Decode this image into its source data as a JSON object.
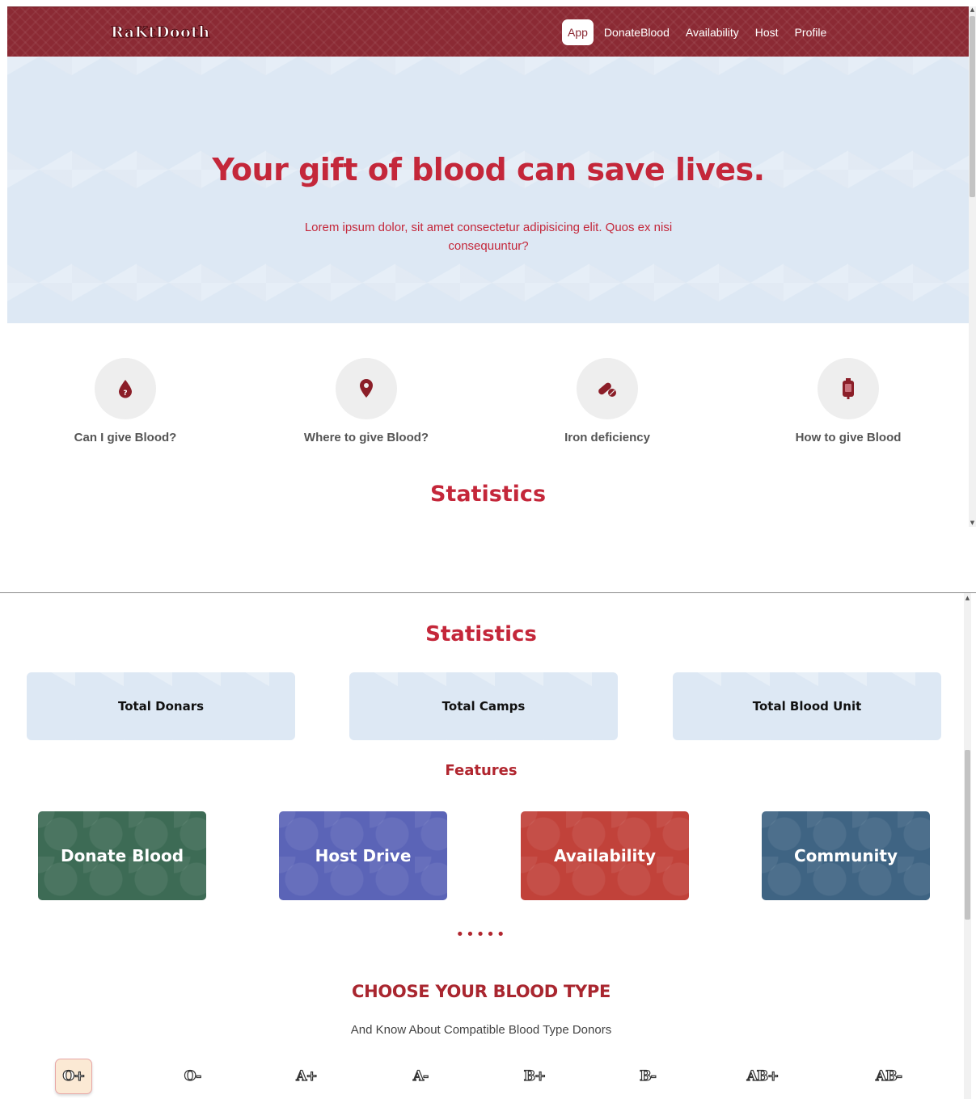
{
  "navbar": {
    "brand": "RaKtDooth",
    "links": [
      "App",
      "DonateBlood",
      "Availability",
      "Host",
      "Profile"
    ],
    "active_link": "App"
  },
  "hero": {
    "title": "Your gift of blood can save lives.",
    "text": "Lorem ipsum dolor, sit amet consectetur adipisicing elit. Quos ex nisi consequuntur?"
  },
  "info_items": [
    {
      "label": "Can I give Blood?",
      "icon": "blood-drop-question-icon"
    },
    {
      "label": "Where to give Blood?",
      "icon": "map-pin-icon"
    },
    {
      "label": "Iron deficiency",
      "icon": "pills-icon"
    },
    {
      "label": "How to give Blood",
      "icon": "blood-bag-icon"
    }
  ],
  "statistics": {
    "heading": "Statistics",
    "cards": [
      "Total Donars",
      "Total Camps",
      "Total Blood Unit"
    ]
  },
  "features": {
    "heading": "Features",
    "cards": [
      {
        "label": "Donate Blood",
        "color": "#3d6b55"
      },
      {
        "label": "Host Drive",
        "color": "#5b64b7"
      },
      {
        "label": "Availability",
        "color": "#c1423a"
      },
      {
        "label": "Community",
        "color": "#3f6483"
      }
    ]
  },
  "divider_dots": "•••••",
  "blood_type": {
    "heading": "CHOOSE YOUR BLOOD TYPE",
    "subtitle": "And Know About Compatible Blood Type Donors",
    "types": [
      "O+",
      "O-",
      "A+",
      "A-",
      "B+",
      "B-",
      "AB+",
      "AB-"
    ],
    "selected": "O+"
  },
  "colors": {
    "accent": "#c4273a",
    "navbar": "#8b2a34",
    "hero_bg": "#dde8f4"
  }
}
